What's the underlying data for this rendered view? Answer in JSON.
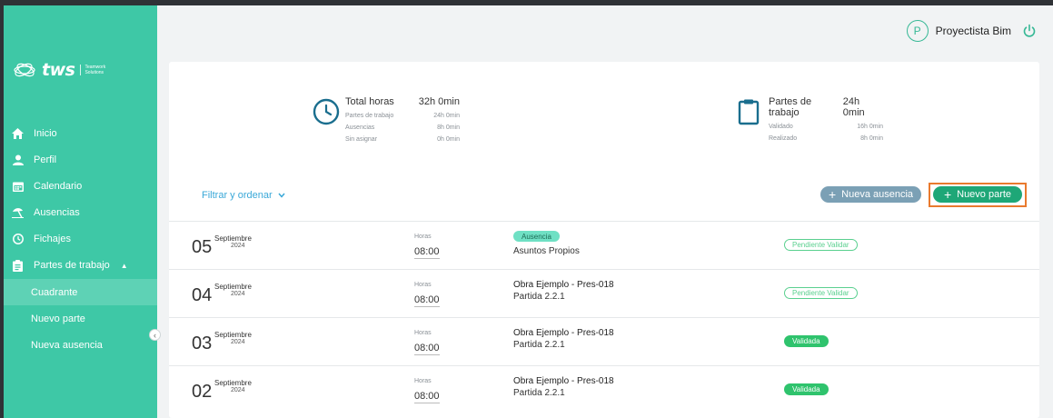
{
  "brand": {
    "name": "tws",
    "tagline_1": "Teamwork",
    "tagline_2": "Solutions"
  },
  "header": {
    "avatar_letter": "P",
    "username": "Proyectista Bim"
  },
  "sidebar": {
    "items": [
      {
        "label": "Inicio",
        "icon": "home-icon"
      },
      {
        "label": "Perfil",
        "icon": "user-icon"
      },
      {
        "label": "Calendario",
        "icon": "calendar-icon"
      },
      {
        "label": "Ausencias",
        "icon": "beach-icon"
      },
      {
        "label": "Fichajes",
        "icon": "clock-icon"
      },
      {
        "label": "Partes de trabajo",
        "icon": "clipboard-icon"
      }
    ],
    "subitems": [
      "Cuadrante",
      "Nuevo parte",
      "Nueva ausencia"
    ]
  },
  "summary_hours": {
    "title": "Total horas",
    "total": "32h 0min",
    "rows": [
      {
        "label": "Partes de trabajo",
        "value": "24h 0min"
      },
      {
        "label": "Ausencias",
        "value": "8h 0min"
      },
      {
        "label": "Sin asignar",
        "value": "0h 0min"
      }
    ]
  },
  "summary_partes": {
    "title": "Partes de trabajo",
    "total": "24h 0min",
    "rows": [
      {
        "label": "Validado",
        "value": "16h 0min"
      },
      {
        "label": "Realizado",
        "value": "8h 0min"
      }
    ]
  },
  "toolbar": {
    "filter_label": "Filtrar y ordenar",
    "nueva_ausencia": "Nueva ausencia",
    "nuevo_parte": "Nuevo parte"
  },
  "entries": [
    {
      "day": "05",
      "month": "Septiembre",
      "year": "2024",
      "horas_label": "Horas",
      "horas": "08:00",
      "badge": "Ausencia",
      "title": "",
      "subtitle": "Asuntos Propios",
      "status": "Pendiente Validar"
    },
    {
      "day": "04",
      "month": "Septiembre",
      "year": "2024",
      "horas_label": "Horas",
      "horas": "08:00",
      "badge": "",
      "title": "Obra Ejemplo - Pres-018",
      "subtitle": "Partida 2.2.1",
      "status": "Pendiente Validar"
    },
    {
      "day": "03",
      "month": "Septiembre",
      "year": "2024",
      "horas_label": "Horas",
      "horas": "08:00",
      "badge": "",
      "title": "Obra Ejemplo - Pres-018",
      "subtitle": "Partida 2.2.1",
      "status": "Validada"
    },
    {
      "day": "02",
      "month": "Septiembre",
      "year": "2024",
      "horas_label": "Horas",
      "horas": "08:00",
      "badge": "",
      "title": "Obra Ejemplo - Pres-018",
      "subtitle": "Partida 2.2.1",
      "status": "Validada"
    }
  ],
  "colors": {
    "sidebar": "#3ec8a6",
    "accent_green": "#1ea777",
    "validada": "#2fc36d",
    "pendiente": "#5ad08f",
    "highlight": "#e97a2e",
    "filter_link": "#3aa8d8"
  }
}
